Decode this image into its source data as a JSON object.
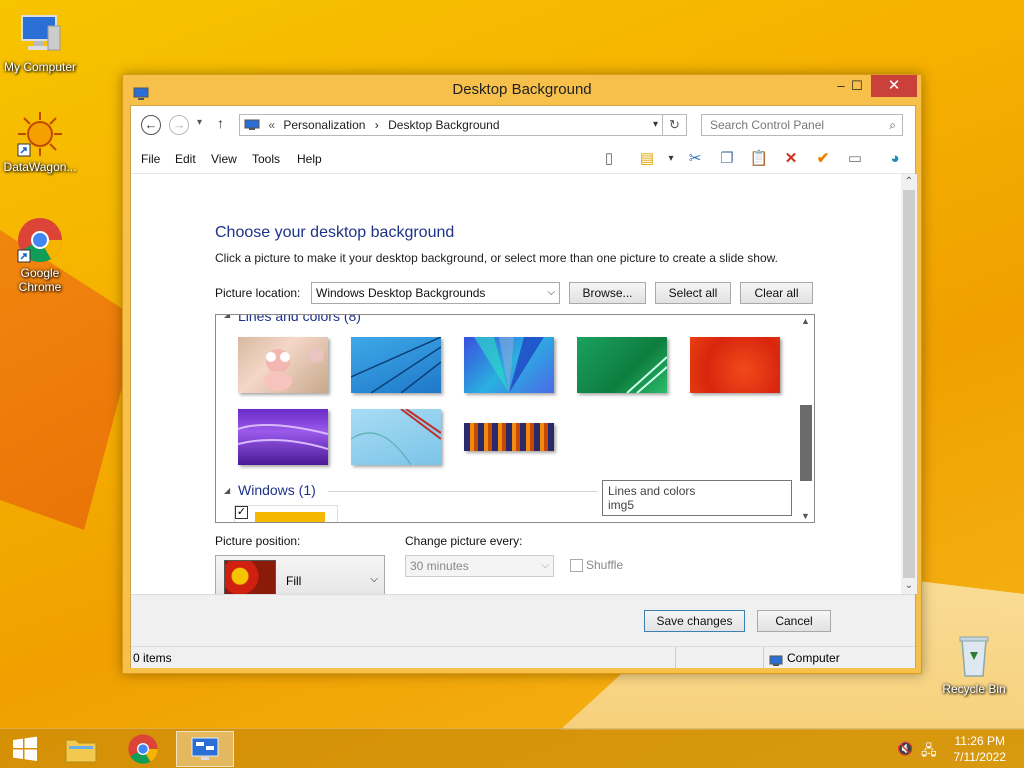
{
  "desktop": {
    "icons": [
      {
        "label": "My Computer"
      },
      {
        "label": "DataWagon..."
      },
      {
        "label": "Google Chrome"
      },
      {
        "label": "Recycle Bin"
      }
    ]
  },
  "window": {
    "title": "Desktop Background",
    "controls": {
      "minimize": "–",
      "maximize": "☐",
      "close": "✕"
    },
    "address": {
      "prefix": "«",
      "crumbs": [
        "Personalization",
        "Desktop Background"
      ],
      "separator": "›"
    },
    "search": {
      "placeholder": "Search Control Panel"
    },
    "menu": [
      "File",
      "Edit",
      "View",
      "Tools",
      "Help"
    ],
    "heading": "Choose your desktop background",
    "subheading": "Click a picture to make it your desktop background, or select more than one picture to create a slide show.",
    "picture_location": {
      "label": "Picture location:",
      "value": "Windows Desktop Backgrounds",
      "browse": "Browse...",
      "select_all": "Select all",
      "clear_all": "Clear all"
    },
    "gallery": {
      "groups": [
        {
          "name": "Lines and colors (8)",
          "count": 8
        },
        {
          "name": "Windows (1)",
          "count": 1
        }
      ],
      "tooltip": {
        "line1": "Lines and colors",
        "line2": "img5"
      }
    },
    "picture_position": {
      "label": "Picture position:",
      "value": "Fill"
    },
    "change_picture": {
      "label": "Change picture every:",
      "value": "30 minutes",
      "shuffle": "Shuffle"
    },
    "buttons": {
      "save": "Save changes",
      "cancel": "Cancel"
    },
    "status": {
      "items": "0 items",
      "location": "Computer"
    }
  },
  "taskbar": {
    "time": "11:26 PM",
    "date": "7/11/2022"
  },
  "colors": {
    "window_frame": "#f7c04a",
    "heading": "#1e3287",
    "close_button": "#c9413a"
  }
}
